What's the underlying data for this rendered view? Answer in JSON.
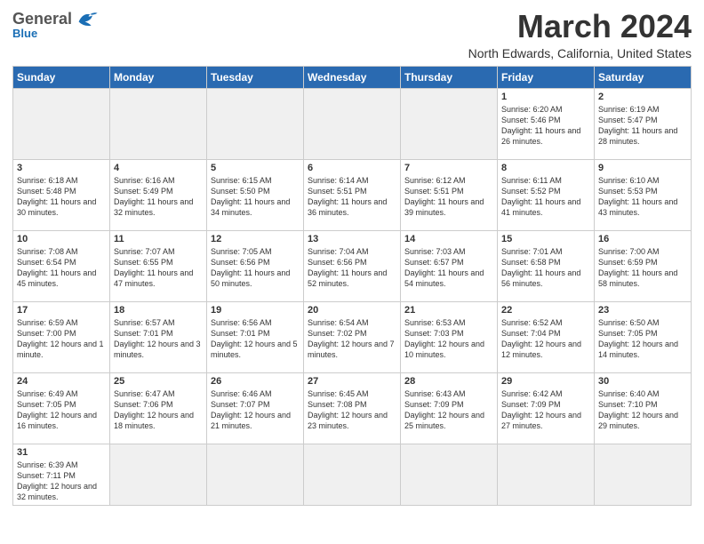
{
  "header": {
    "logo_general": "General",
    "logo_blue": "Blue",
    "title": "March 2024",
    "subtitle": "North Edwards, California, United States"
  },
  "days_of_week": [
    "Sunday",
    "Monday",
    "Tuesday",
    "Wednesday",
    "Thursday",
    "Friday",
    "Saturday"
  ],
  "weeks": [
    [
      {
        "day": "",
        "info": "",
        "empty": true
      },
      {
        "day": "",
        "info": "",
        "empty": true
      },
      {
        "day": "",
        "info": "",
        "empty": true
      },
      {
        "day": "",
        "info": "",
        "empty": true
      },
      {
        "day": "",
        "info": "",
        "empty": true
      },
      {
        "day": "1",
        "info": "Sunrise: 6:20 AM\nSunset: 5:46 PM\nDaylight: 11 hours and 26 minutes."
      },
      {
        "day": "2",
        "info": "Sunrise: 6:19 AM\nSunset: 5:47 PM\nDaylight: 11 hours and 28 minutes."
      }
    ],
    [
      {
        "day": "3",
        "info": "Sunrise: 6:18 AM\nSunset: 5:48 PM\nDaylight: 11 hours and 30 minutes."
      },
      {
        "day": "4",
        "info": "Sunrise: 6:16 AM\nSunset: 5:49 PM\nDaylight: 11 hours and 32 minutes."
      },
      {
        "day": "5",
        "info": "Sunrise: 6:15 AM\nSunset: 5:50 PM\nDaylight: 11 hours and 34 minutes."
      },
      {
        "day": "6",
        "info": "Sunrise: 6:14 AM\nSunset: 5:51 PM\nDaylight: 11 hours and 36 minutes."
      },
      {
        "day": "7",
        "info": "Sunrise: 6:12 AM\nSunset: 5:51 PM\nDaylight: 11 hours and 39 minutes."
      },
      {
        "day": "8",
        "info": "Sunrise: 6:11 AM\nSunset: 5:52 PM\nDaylight: 11 hours and 41 minutes."
      },
      {
        "day": "9",
        "info": "Sunrise: 6:10 AM\nSunset: 5:53 PM\nDaylight: 11 hours and 43 minutes."
      }
    ],
    [
      {
        "day": "10",
        "info": "Sunrise: 7:08 AM\nSunset: 6:54 PM\nDaylight: 11 hours and 45 minutes."
      },
      {
        "day": "11",
        "info": "Sunrise: 7:07 AM\nSunset: 6:55 PM\nDaylight: 11 hours and 47 minutes."
      },
      {
        "day": "12",
        "info": "Sunrise: 7:05 AM\nSunset: 6:56 PM\nDaylight: 11 hours and 50 minutes."
      },
      {
        "day": "13",
        "info": "Sunrise: 7:04 AM\nSunset: 6:56 PM\nDaylight: 11 hours and 52 minutes."
      },
      {
        "day": "14",
        "info": "Sunrise: 7:03 AM\nSunset: 6:57 PM\nDaylight: 11 hours and 54 minutes."
      },
      {
        "day": "15",
        "info": "Sunrise: 7:01 AM\nSunset: 6:58 PM\nDaylight: 11 hours and 56 minutes."
      },
      {
        "day": "16",
        "info": "Sunrise: 7:00 AM\nSunset: 6:59 PM\nDaylight: 11 hours and 58 minutes."
      }
    ],
    [
      {
        "day": "17",
        "info": "Sunrise: 6:59 AM\nSunset: 7:00 PM\nDaylight: 12 hours and 1 minute."
      },
      {
        "day": "18",
        "info": "Sunrise: 6:57 AM\nSunset: 7:01 PM\nDaylight: 12 hours and 3 minutes."
      },
      {
        "day": "19",
        "info": "Sunrise: 6:56 AM\nSunset: 7:01 PM\nDaylight: 12 hours and 5 minutes."
      },
      {
        "day": "20",
        "info": "Sunrise: 6:54 AM\nSunset: 7:02 PM\nDaylight: 12 hours and 7 minutes."
      },
      {
        "day": "21",
        "info": "Sunrise: 6:53 AM\nSunset: 7:03 PM\nDaylight: 12 hours and 10 minutes."
      },
      {
        "day": "22",
        "info": "Sunrise: 6:52 AM\nSunset: 7:04 PM\nDaylight: 12 hours and 12 minutes."
      },
      {
        "day": "23",
        "info": "Sunrise: 6:50 AM\nSunset: 7:05 PM\nDaylight: 12 hours and 14 minutes."
      }
    ],
    [
      {
        "day": "24",
        "info": "Sunrise: 6:49 AM\nSunset: 7:05 PM\nDaylight: 12 hours and 16 minutes."
      },
      {
        "day": "25",
        "info": "Sunrise: 6:47 AM\nSunset: 7:06 PM\nDaylight: 12 hours and 18 minutes."
      },
      {
        "day": "26",
        "info": "Sunrise: 6:46 AM\nSunset: 7:07 PM\nDaylight: 12 hours and 21 minutes."
      },
      {
        "day": "27",
        "info": "Sunrise: 6:45 AM\nSunset: 7:08 PM\nDaylight: 12 hours and 23 minutes."
      },
      {
        "day": "28",
        "info": "Sunrise: 6:43 AM\nSunset: 7:09 PM\nDaylight: 12 hours and 25 minutes."
      },
      {
        "day": "29",
        "info": "Sunrise: 6:42 AM\nSunset: 7:09 PM\nDaylight: 12 hours and 27 minutes."
      },
      {
        "day": "30",
        "info": "Sunrise: 6:40 AM\nSunset: 7:10 PM\nDaylight: 12 hours and 29 minutes."
      }
    ],
    [
      {
        "day": "31",
        "info": "Sunrise: 6:39 AM\nSunset: 7:11 PM\nDaylight: 12 hours and 32 minutes."
      },
      {
        "day": "",
        "info": "",
        "empty": true
      },
      {
        "day": "",
        "info": "",
        "empty": true
      },
      {
        "day": "",
        "info": "",
        "empty": true
      },
      {
        "day": "",
        "info": "",
        "empty": true
      },
      {
        "day": "",
        "info": "",
        "empty": true
      },
      {
        "day": "",
        "info": "",
        "empty": true
      }
    ]
  ]
}
